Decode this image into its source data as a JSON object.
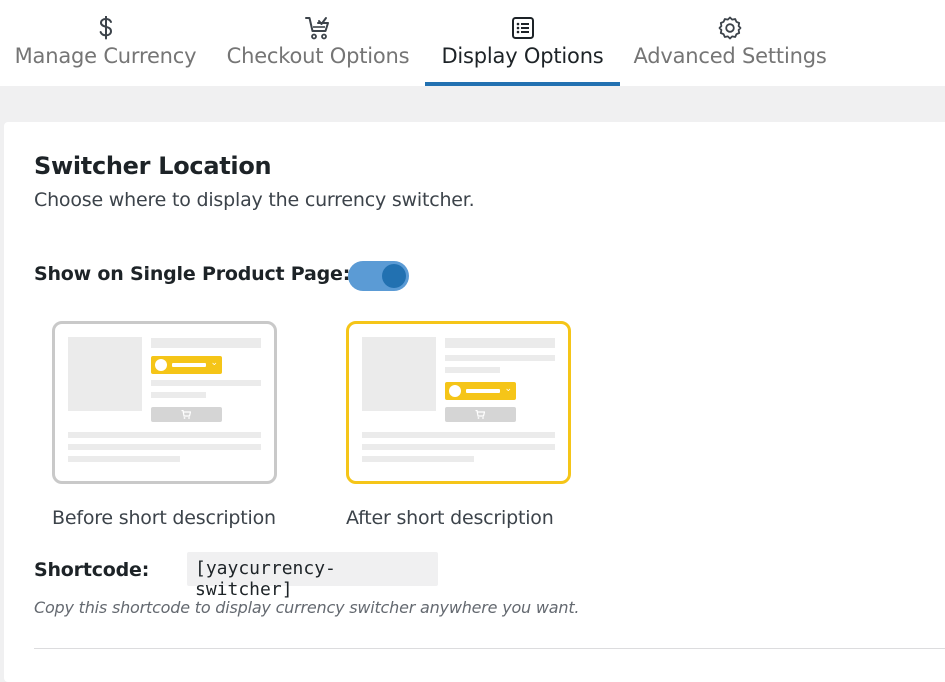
{
  "tabs": [
    {
      "label": "Manage Currency",
      "icon": "dollar-icon",
      "active": false
    },
    {
      "label": "Checkout Options",
      "icon": "cart-check-icon",
      "active": false
    },
    {
      "label": "Display Options",
      "icon": "list-icon",
      "active": true
    },
    {
      "label": "Advanced Settings",
      "icon": "gear-icon",
      "active": false
    }
  ],
  "section": {
    "title": "Switcher Location",
    "subtitle": "Choose where to display the currency switcher."
  },
  "toggle": {
    "label": "Show on Single Product Page:",
    "enabled": true
  },
  "options": [
    {
      "label": "Before short description",
      "selected": false
    },
    {
      "label": "After short description",
      "selected": true
    }
  ],
  "shortcode": {
    "label": "Shortcode:",
    "value": "[yaycurrency-switcher]",
    "help": "Copy this shortcode to display currency switcher anywhere you want."
  },
  "colors": {
    "accent": "#2271b1",
    "toggle_track": "#5b9bd5",
    "selected_border": "#f5c518",
    "switcher_yellow": "#f5c518"
  }
}
